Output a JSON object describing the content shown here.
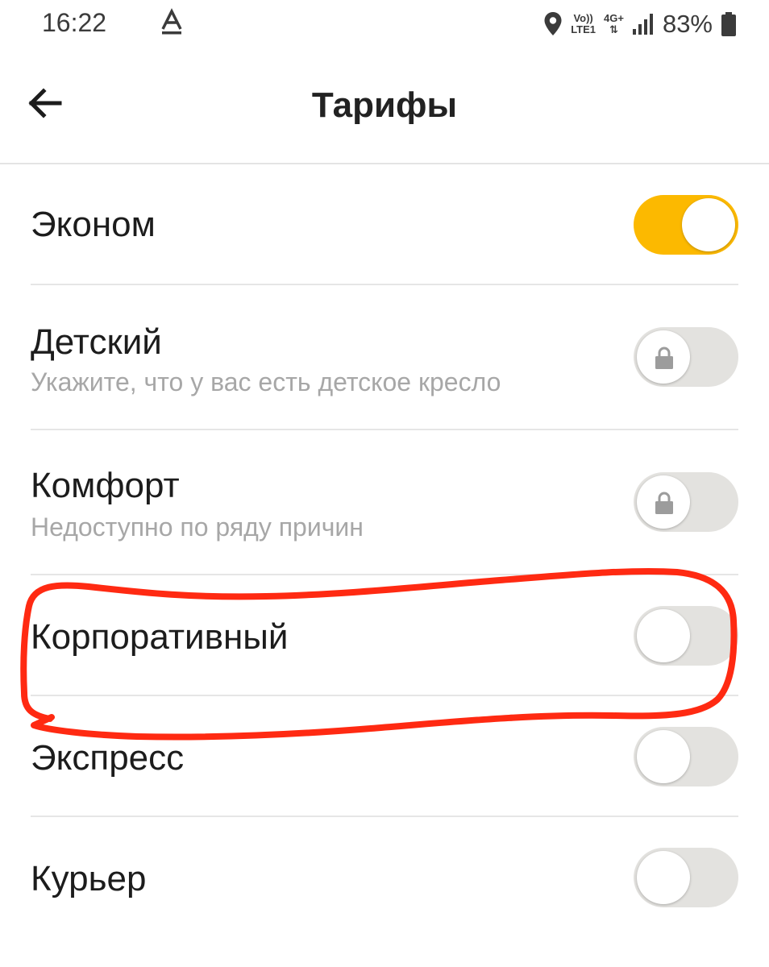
{
  "status_bar": {
    "time": "16:22",
    "carrier_icon": "a-letter-icon",
    "network_top": "Vo))",
    "network_bottom": "LTE1",
    "data_type": "4G+",
    "battery_percent": "83%",
    "icons": [
      "location-pin-icon",
      "signal-icon",
      "battery-icon"
    ]
  },
  "header": {
    "title": "Тарифы",
    "back_icon": "arrow-left-icon"
  },
  "tariffs": [
    {
      "title": "Эконом",
      "subtitle": "",
      "enabled": true,
      "locked": false
    },
    {
      "title": "Детский",
      "subtitle": "Укажите, что у вас есть детское кресло",
      "enabled": false,
      "locked": true
    },
    {
      "title": "Комфорт",
      "subtitle": "Недоступно по ряду причин",
      "enabled": false,
      "locked": true
    },
    {
      "title": "Корпоративный",
      "subtitle": "",
      "enabled": false,
      "locked": false
    },
    {
      "title": "Экспресс",
      "subtitle": "",
      "enabled": false,
      "locked": false
    },
    {
      "title": "Курьер",
      "subtitle": "",
      "enabled": false,
      "locked": false
    }
  ],
  "colors": {
    "toggle_on": "#fcb900",
    "toggle_off": "#e3e2df",
    "annotation": "#ff2a12",
    "subtitle": "#a7a7a7"
  }
}
